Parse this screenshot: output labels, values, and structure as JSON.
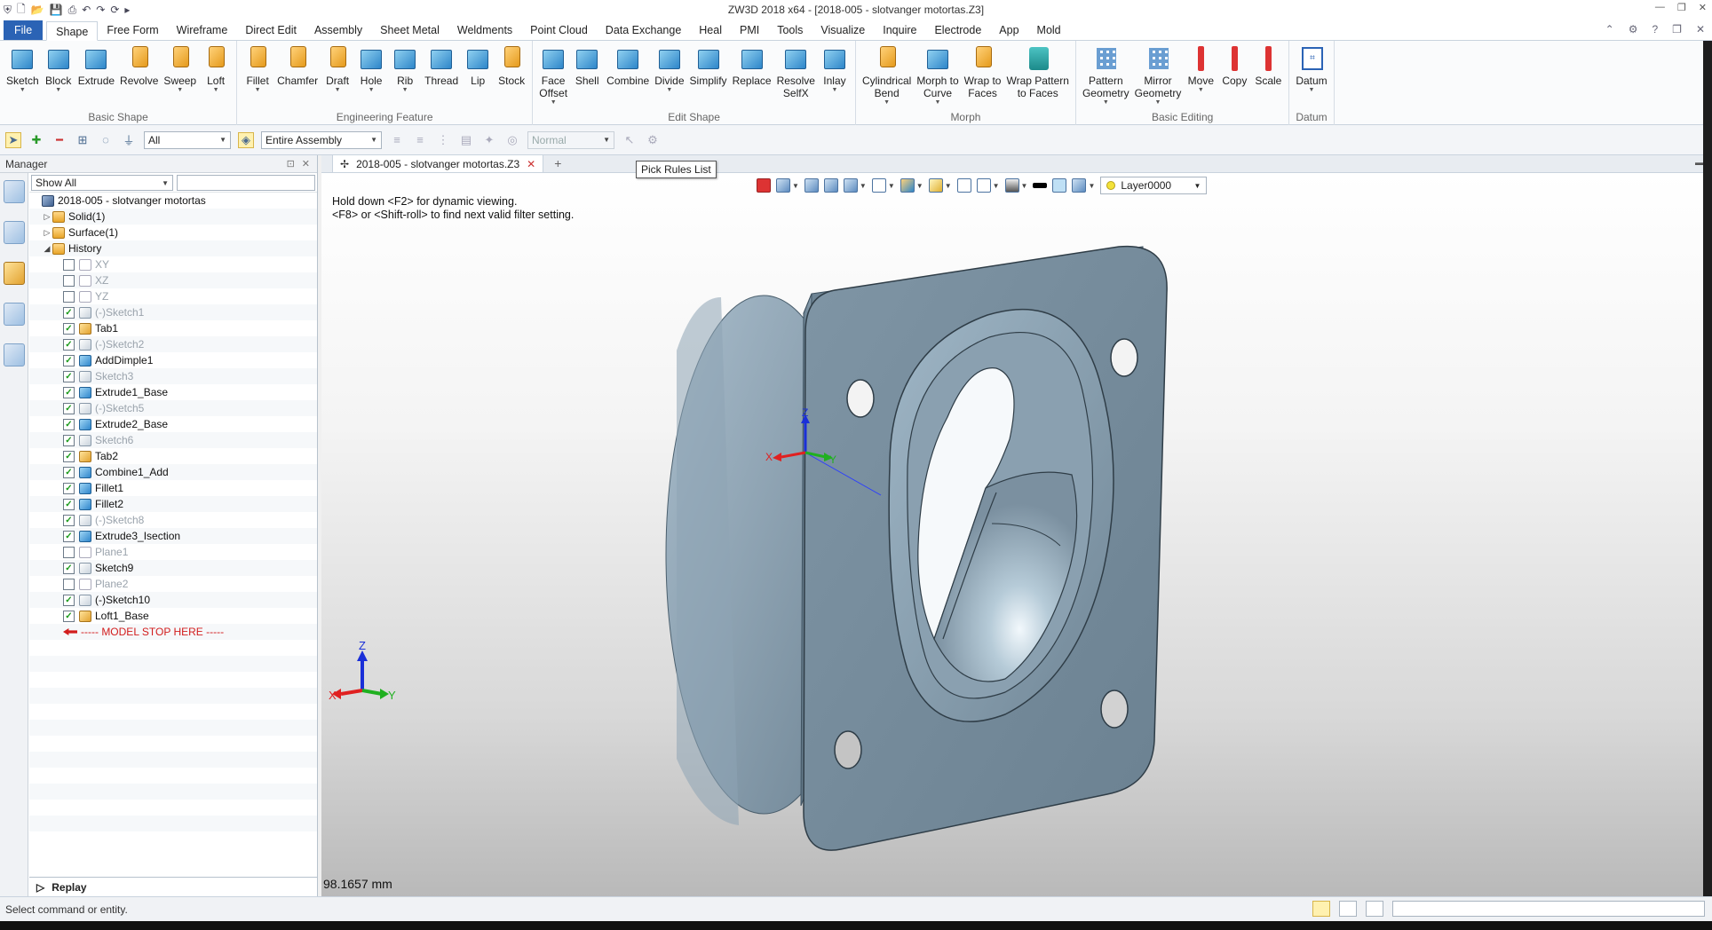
{
  "app": {
    "window_title": "ZW3D 2018 x64 - [2018-005 - slotvanger motortas.Z3]"
  },
  "menu": {
    "tabs": [
      "File",
      "Shape",
      "Free Form",
      "Wireframe",
      "Direct Edit",
      "Assembly",
      "Sheet Metal",
      "Weldments",
      "Point Cloud",
      "Data Exchange",
      "Heal",
      "PMI",
      "Tools",
      "Visualize",
      "Inquire",
      "Electrode",
      "App",
      "Mold"
    ],
    "active": "Shape"
  },
  "ribbon": {
    "groups": [
      {
        "label": "Basic Shape",
        "buttons": [
          {
            "label": "Sketch",
            "icon": "sketch-icon"
          },
          {
            "label": "Block",
            "icon": "block-icon"
          },
          {
            "label": "Extrude",
            "icon": "extrude-icon"
          },
          {
            "label": "Revolve",
            "icon": "revolve-icon"
          },
          {
            "label": "Sweep",
            "icon": "sweep-icon"
          },
          {
            "label": "Loft",
            "icon": "loft-icon"
          }
        ]
      },
      {
        "label": "Engineering Feature",
        "buttons": [
          {
            "label": "Fillet",
            "icon": "fillet-icon"
          },
          {
            "label": "Chamfer",
            "icon": "chamfer-icon"
          },
          {
            "label": "Draft",
            "icon": "draft-icon"
          },
          {
            "label": "Hole",
            "icon": "hole-icon"
          },
          {
            "label": "Rib",
            "icon": "rib-icon"
          },
          {
            "label": "Thread",
            "icon": "thread-icon"
          },
          {
            "label": "Lip",
            "icon": "lip-icon"
          },
          {
            "label": "Stock",
            "icon": "stock-icon"
          }
        ]
      },
      {
        "label": "Edit Shape",
        "buttons": [
          {
            "label": "Face\nOffset",
            "icon": "face-offset-icon"
          },
          {
            "label": "Shell",
            "icon": "shell-icon"
          },
          {
            "label": "Combine",
            "icon": "combine-icon"
          },
          {
            "label": "Divide",
            "icon": "divide-icon"
          },
          {
            "label": "Simplify",
            "icon": "simplify-icon"
          },
          {
            "label": "Replace",
            "icon": "replace-icon"
          },
          {
            "label": "Resolve\nSelfX",
            "icon": "resolve-selfx-icon"
          },
          {
            "label": "Inlay",
            "icon": "inlay-icon"
          }
        ]
      },
      {
        "label": "Morph",
        "buttons": [
          {
            "label": "Cylindrical\nBend",
            "icon": "cylindrical-bend-icon"
          },
          {
            "label": "Morph to\nCurve",
            "icon": "morph-to-curve-icon"
          },
          {
            "label": "Wrap to\nFaces",
            "icon": "wrap-to-faces-icon"
          },
          {
            "label": "Wrap Pattern\nto Faces",
            "icon": "wrap-pattern-icon"
          }
        ]
      },
      {
        "label": "Basic Editing",
        "buttons": [
          {
            "label": "Pattern\nGeometry",
            "icon": "pattern-geometry-icon"
          },
          {
            "label": "Mirror\nGeometry",
            "icon": "mirror-geometry-icon"
          },
          {
            "label": "Move",
            "icon": "move-icon"
          },
          {
            "label": "Copy",
            "icon": "copy-icon"
          },
          {
            "label": "Scale",
            "icon": "scale-icon"
          }
        ]
      },
      {
        "label": "Datum",
        "buttons": [
          {
            "label": "Datum",
            "icon": "datum-icon"
          }
        ]
      }
    ]
  },
  "toolbar2": {
    "filter_value": "All",
    "scope_value": "Entire Assembly",
    "mode_value": "Normal"
  },
  "manager": {
    "title": "Manager",
    "filter_value": "Show All",
    "tree": [
      {
        "label": "2018-005 - slotvanger motortas",
        "indent": 0,
        "icon": "asm",
        "exp": "",
        "cb": null,
        "dim": false
      },
      {
        "label": "Solid(1)",
        "indent": 1,
        "icon": "folder",
        "exp": "▷",
        "cb": null,
        "dim": false
      },
      {
        "label": "Surface(1)",
        "indent": 1,
        "icon": "folder",
        "exp": "▷",
        "cb": null,
        "dim": false
      },
      {
        "label": "History",
        "indent": 1,
        "icon": "folder",
        "exp": "◢",
        "cb": null,
        "dim": false
      },
      {
        "label": "XY",
        "indent": 2,
        "icon": "plane",
        "exp": "",
        "cb": false,
        "dim": true
      },
      {
        "label": "XZ",
        "indent": 2,
        "icon": "plane",
        "exp": "",
        "cb": false,
        "dim": true
      },
      {
        "label": "YZ",
        "indent": 2,
        "icon": "plane",
        "exp": "",
        "cb": false,
        "dim": true
      },
      {
        "label": "(-)Sketch1",
        "indent": 2,
        "icon": "sketch",
        "exp": "",
        "cb": true,
        "dim": true
      },
      {
        "label": "Tab1",
        "indent": 2,
        "icon": "tab",
        "exp": "",
        "cb": true,
        "dim": false
      },
      {
        "label": "(-)Sketch2",
        "indent": 2,
        "icon": "sketch",
        "exp": "",
        "cb": true,
        "dim": true
      },
      {
        "label": "AddDimple1",
        "indent": 2,
        "icon": "feat",
        "exp": "",
        "cb": true,
        "dim": false
      },
      {
        "label": "Sketch3",
        "indent": 2,
        "icon": "sketch",
        "exp": "",
        "cb": true,
        "dim": true
      },
      {
        "label": "Extrude1_Base",
        "indent": 2,
        "icon": "feat",
        "exp": "",
        "cb": true,
        "dim": false
      },
      {
        "label": "(-)Sketch5",
        "indent": 2,
        "icon": "sketch",
        "exp": "",
        "cb": true,
        "dim": true
      },
      {
        "label": "Extrude2_Base",
        "indent": 2,
        "icon": "feat",
        "exp": "",
        "cb": true,
        "dim": false
      },
      {
        "label": "Sketch6",
        "indent": 2,
        "icon": "sketch",
        "exp": "",
        "cb": true,
        "dim": true
      },
      {
        "label": "Tab2",
        "indent": 2,
        "icon": "tab",
        "exp": "",
        "cb": true,
        "dim": false
      },
      {
        "label": "Combine1_Add",
        "indent": 2,
        "icon": "feat",
        "exp": "",
        "cb": true,
        "dim": false
      },
      {
        "label": "Fillet1",
        "indent": 2,
        "icon": "feat",
        "exp": "",
        "cb": true,
        "dim": false
      },
      {
        "label": "Fillet2",
        "indent": 2,
        "icon": "feat",
        "exp": "",
        "cb": true,
        "dim": false
      },
      {
        "label": "(-)Sketch8",
        "indent": 2,
        "icon": "sketch",
        "exp": "",
        "cb": true,
        "dim": true
      },
      {
        "label": "Extrude3_Isection",
        "indent": 2,
        "icon": "feat",
        "exp": "",
        "cb": true,
        "dim": false
      },
      {
        "label": "Plane1",
        "indent": 2,
        "icon": "plane",
        "exp": "",
        "cb": false,
        "dim": true
      },
      {
        "label": "Sketch9",
        "indent": 2,
        "icon": "sketch",
        "exp": "",
        "cb": true,
        "dim": false
      },
      {
        "label": "Plane2",
        "indent": 2,
        "icon": "plane",
        "exp": "",
        "cb": false,
        "dim": true
      },
      {
        "label": "(-)Sketch10",
        "indent": 2,
        "icon": "sketch",
        "exp": "",
        "cb": true,
        "dim": false
      },
      {
        "label": "Loft1_Base",
        "indent": 2,
        "icon": "tab",
        "exp": "",
        "cb": true,
        "dim": false
      },
      {
        "label": "----- MODEL STOP HERE -----",
        "indent": 2,
        "icon": "arrow",
        "exp": "",
        "cb": null,
        "dim": false,
        "stop": true
      }
    ],
    "replay_label": "Replay"
  },
  "document": {
    "tab_label": "2018-005 - slotvanger motortas.Z3",
    "tooltip": "Pick Rules List",
    "hint_line1": "Hold down <F2> for dynamic viewing.",
    "hint_line2": "<F8> or <Shift-roll> to find next valid filter setting.",
    "layer": "Layer0000",
    "scale_readout": "98.1657 mm",
    "triad": {
      "x": "X",
      "y": "Y",
      "z": "Z"
    }
  },
  "colors": {
    "part_fill": "#7d93a3",
    "part_light": "#b9ccd8",
    "accent": "#2b63b5"
  },
  "status": {
    "prompt": "Select command or entity."
  }
}
